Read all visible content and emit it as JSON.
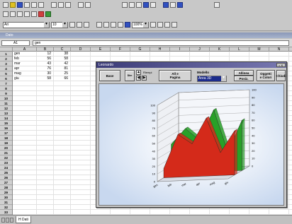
{
  "menu": {
    "partial_labels": [
      "Ar",
      "Kk",
      "Bo",
      "Fi",
      "Gi"
    ]
  },
  "toolbar3": {
    "font_name": "Ari",
    "font_size": "10",
    "zoom": "100%"
  },
  "sheet_title": "Dato",
  "formula_bar": {
    "cell_ref": "A1",
    "content": "gen"
  },
  "columns": [
    "A",
    "B",
    "C",
    "D",
    "E",
    "F",
    "G",
    "H",
    "I",
    "J",
    "K",
    "L",
    "M",
    "N"
  ],
  "rows": [
    "1",
    "2",
    "3",
    "4",
    "5",
    "6",
    "7",
    "8",
    "9",
    "10",
    "11",
    "12",
    "13",
    "14",
    "15",
    "16",
    "17",
    "18",
    "19",
    "20",
    "21",
    "22",
    "23",
    "24",
    "25",
    "26",
    "27",
    "28",
    "29",
    "30",
    "31",
    "32",
    "33"
  ],
  "cells": [
    {
      "a": "gen",
      "b": "12",
      "c": "38"
    },
    {
      "a": "feb",
      "b": "56",
      "c": "58"
    },
    {
      "a": "mar",
      "b": "43",
      "c": "42"
    },
    {
      "a": "apr",
      "b": "76",
      "c": "81"
    },
    {
      "a": "mag",
      "b": "30",
      "c": "25"
    },
    {
      "a": "giu",
      "b": "58",
      "c": "66"
    }
  ],
  "sheet_tab": "Dati",
  "sheet_tab_prefix": "H",
  "chart_window": {
    "title": "Leonardo",
    "buttons": {
      "basic": "Base",
      "size_stepper": "Dim",
      "fill_label": "Riempi",
      "all_and_pageset": "All e\nPagina",
      "model_label": "Modello",
      "model_value": "Area 3D",
      "align": "Allinea",
      "position": "Posiz.",
      "objects_and_colors": "Oggetti\ne Colori",
      "close": "Chiudi"
    }
  },
  "chart_data": {
    "type": "area",
    "title": "",
    "xlabel": "",
    "ylabel": "",
    "categories": [
      "gen",
      "feb",
      "mar",
      "apr",
      "mag",
      "giu"
    ],
    "series": [
      {
        "values": [
          12,
          56,
          43,
          76,
          30,
          58
        ],
        "color": "#d42a1a"
      },
      {
        "values": [
          38,
          58,
          42,
          81,
          25,
          66
        ],
        "color": "#28a028"
      }
    ],
    "ylim": [
      0,
      100
    ],
    "yticks": [
      "0",
      "10",
      "20",
      "30",
      "40",
      "50",
      "60",
      "70",
      "80",
      "90",
      "100"
    ],
    "grid": true,
    "three_d": true
  }
}
